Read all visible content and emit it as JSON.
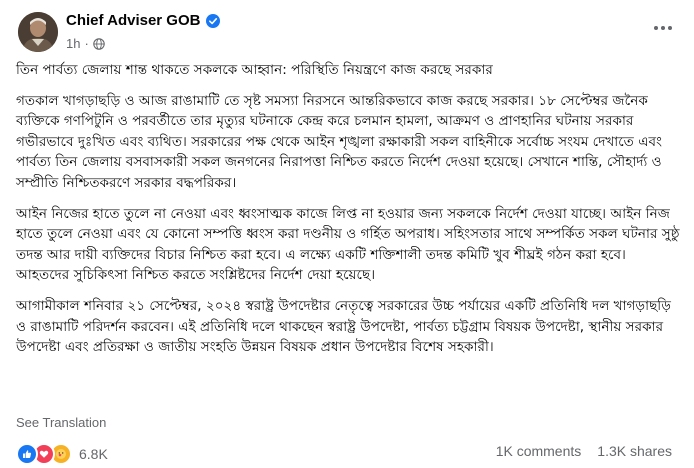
{
  "post": {
    "author": "Chief Adviser GOB",
    "time": "1h",
    "paragraphs": [
      "তিন পার্বত্য জেলায় শান্ত থাকতে সকলকে আহ্বান: পরিস্থিতি নিয়ন্ত্রণে কাজ করছে সরকার",
      "গতকাল খাগড়াছড়ি ও আজ রাঙামাটি তে সৃষ্ট সমস্যা নিরসনে আন্তরিকভাবে কাজ করছে সরকার। ১৮ সেপ্টেম্বর জনৈক ব্যক্তিকে গণপিটুনি ও পরবর্তীতে তার মৃত্যুর ঘটনাকে কেন্দ্র করে চলমান হামলা, আক্রমণ ও প্রাণহানির ঘটনায় সরকার গভীরভাবে দুঃখিত এবং ব্যথিত। সরকারের পক্ষ থেকে আইন শৃঙ্খলা রক্ষাকারী সকল বাহিনীকে সর্বোচ্চ সংযম দেখাতে এবং পার্বত্য তিন জেলায় বসবাসকারী সকল জনগনের নিরাপত্তা নিশ্চিত করতে নির্দেশ দেওয়া হয়েছে। সেখানে শান্তি, সৌহার্দ্য ও সম্প্রীতি নিশ্চিতকরণে সরকার বদ্ধপরিকর।",
      "আইন নিজের হাতে তুলে না নেওয়া এবং ধ্বংসাত্মক কাজে লিপ্ত না হওয়ার জন্য সকলকে নির্দেশ দেওয়া যাচ্ছে। আইন নিজ হাতে তুলে নেওয়া এবং যে কোনো সম্পত্তি ধ্বংস করা দণ্ডনীয় ও গর্হিত অপরাধ। সহিংসতার সাথে সম্পর্কিত সকল ঘটনার সুষ্ঠু তদন্ত আর দায়ী ব্যক্তিদের বিচার নিশ্চিত করা হবে। এ লক্ষ্যে একটি শক্তিশালী তদন্ত কমিটি খুব শীঘ্রই গঠন করা হবে। আহতদের সুচিকিৎসা নিশ্চিত করতে সংশ্লিষ্টদের নির্দেশ দেয়া হয়েছে।",
      "আগামীকাল শনিবার ২১ সেপ্টেম্বর, ২০২৪ স্বরাষ্ট্র উপদেষ্টার নেতৃত্বে সরকারের উচ্চ পর্যায়ের একটি প্রতিনিধি দল খাগড়াছড়ি ও রাঙামাটি পরিদর্শন করবেন। এই প্রতিনিধি দলে থাকছেন স্বরাষ্ট্র উপদেষ্টা, পার্বত্য চট্টগ্রাম বিষয়ক উপদেষ্টা, স্থানীয় সরকার উপদেষ্টা এবং প্রতিরক্ষা ও জাতীয় সংহতি উন্নয়ন বিষয়ক প্রধান উপদেষ্টার বিশেষ সহকারী।"
    ],
    "see_translation": "See Translation",
    "reaction_count": "6.8K",
    "comments": "1K comments",
    "shares": "1.3K shares"
  },
  "colors": {
    "brand_blue": "#1877f2",
    "secondary_text": "#65676b",
    "love_red": "#f33e58",
    "care_yellow": "#f7b125"
  },
  "icons": [
    "verified-badge-icon",
    "globe-icon",
    "more-options-icon",
    "like-reaction-icon",
    "love-reaction-icon",
    "care-reaction-icon"
  ]
}
